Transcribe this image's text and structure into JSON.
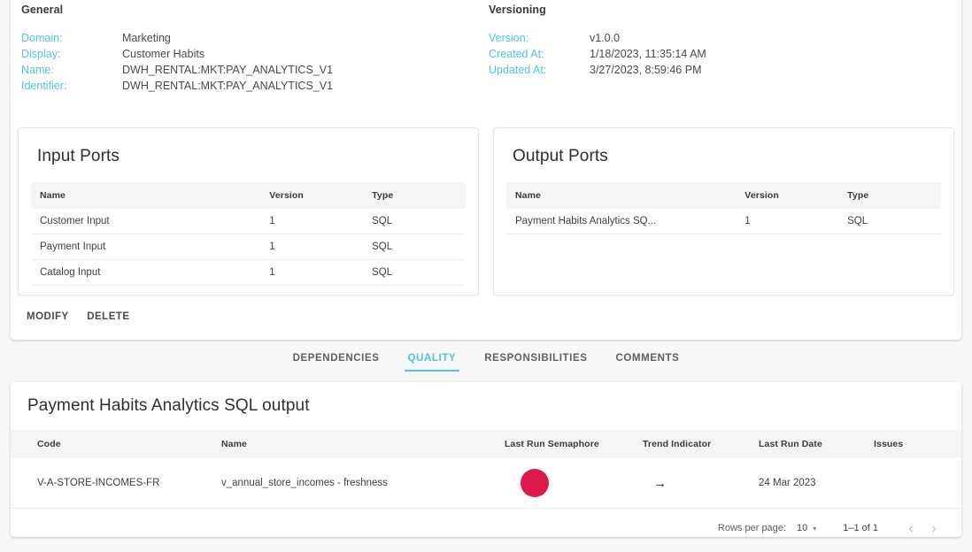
{
  "general": {
    "title": "General",
    "fields": [
      {
        "label": "Domain:",
        "value": "Marketing"
      },
      {
        "label": "Display:",
        "value": "Customer Habits"
      },
      {
        "label": "Name:",
        "value": "DWH_RENTAL:MKT:PAY_ANALYTICS_V1"
      },
      {
        "label": "Identifier:",
        "value": "DWH_RENTAL:MKT:PAY_ANALYTICS_V1"
      }
    ]
  },
  "versioning": {
    "title": "Versioning",
    "fields": [
      {
        "label": "Version:",
        "value": "v1.0.0"
      },
      {
        "label": "Created At:",
        "value": "1/18/2023, 11:35:14 AM"
      },
      {
        "label": "Updated At:",
        "value": "3/27/2023, 8:59:46 PM"
      }
    ]
  },
  "input_ports": {
    "title": "Input Ports",
    "columns": [
      "Name",
      "Version",
      "Type"
    ],
    "rows": [
      {
        "name": "Customer Input",
        "version": "1",
        "type": "SQL"
      },
      {
        "name": "Payment Input",
        "version": "1",
        "type": "SQL"
      },
      {
        "name": "Catalog Input",
        "version": "1",
        "type": "SQL"
      }
    ]
  },
  "output_ports": {
    "title": "Output Ports",
    "columns": [
      "Name",
      "Version",
      "Type"
    ],
    "rows": [
      {
        "name": "Payment Habits Analytics SQ...",
        "version": "1",
        "type": "SQL"
      }
    ]
  },
  "actions": {
    "modify": "MODIFY",
    "delete": "DELETE"
  },
  "tabs": [
    {
      "label": "DEPENDENCIES",
      "active": false
    },
    {
      "label": "QUALITY",
      "active": true
    },
    {
      "label": "RESPONSIBILITIES",
      "active": false
    },
    {
      "label": "COMMENTS",
      "active": false
    }
  ],
  "quality": {
    "title": "Payment Habits Analytics SQL output",
    "columns": [
      "Code",
      "Name",
      "Last Run Semaphore",
      "Trend Indicator",
      "Last Run Date",
      "Issues"
    ],
    "rows": [
      {
        "code": "V-A-STORE-INCOMES-FR",
        "name": "v_annual_store_incomes - freshness",
        "semaphore_color": "#dd1b4a",
        "trend": "→",
        "last_run_date": "24 Mar 2023",
        "issues": ""
      }
    ]
  },
  "paginator": {
    "rows_per_page_label": "Rows per page:",
    "rows_per_page_value": "10",
    "caret": "▾",
    "range": "1–1 of 1",
    "prev": "‹",
    "next": "›"
  },
  "colors": {
    "accent": "#4fc3e4",
    "semaphore_red": "#dd1b4a",
    "page_bg": "#f7f7f7",
    "header_bg": "#f5f5f5"
  }
}
